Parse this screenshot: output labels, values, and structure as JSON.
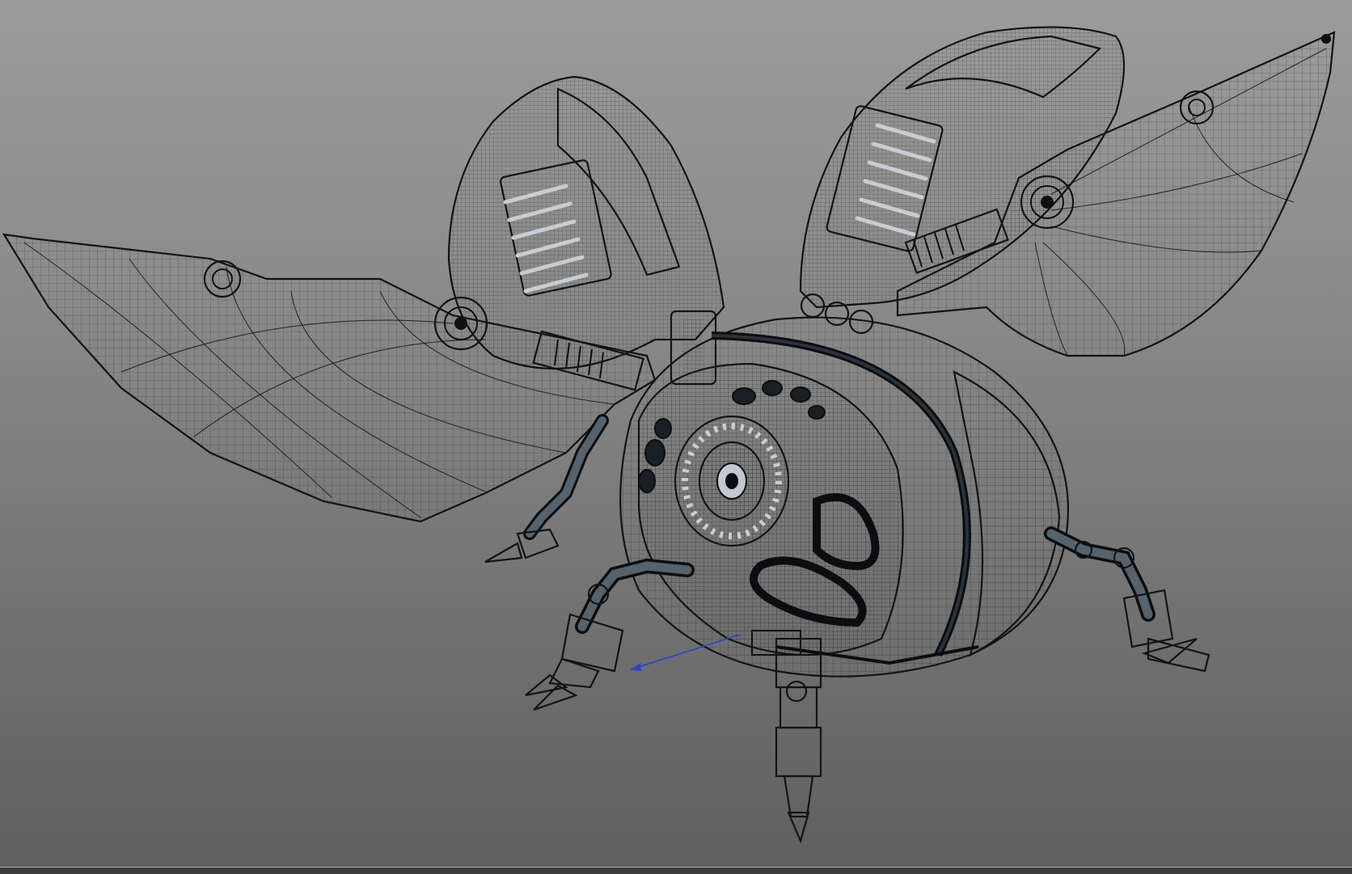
{
  "app": {
    "view": "3D viewport",
    "shading_mode": "wireframe-on-shaded"
  },
  "colors": {
    "viewport_top": "#9b9b9b",
    "viewport_bottom": "#5f5f5f",
    "mesh_fill": "#4a5866",
    "mesh_fill_dark": "#2c343c",
    "wire": "#0d1013",
    "manipulator_axis": "#3040c8"
  },
  "icons": {
    "model": "robotic-beetle-mesh",
    "manipulator": "transform-axis-arrow"
  }
}
